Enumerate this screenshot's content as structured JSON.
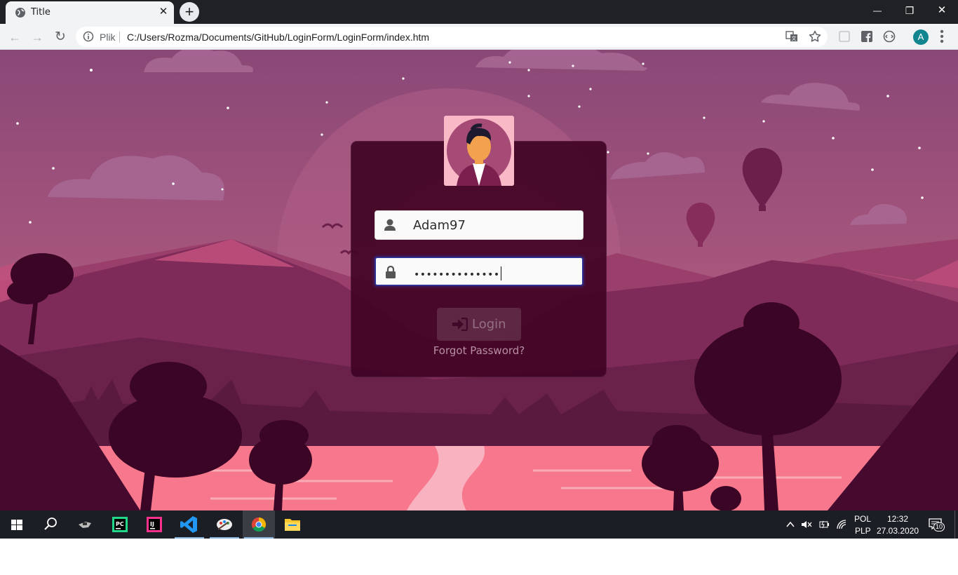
{
  "browser": {
    "tab_title": "Title",
    "tab_close": "✕",
    "new_tab": "+",
    "win_minimize": "—",
    "win_restore": "❐",
    "win_close": "✕",
    "back_icon": "←",
    "forward_icon": "→",
    "reload_icon": "↻",
    "url_scheme_label": "Plik",
    "url": "C:/Users/Rozma/Documents/GitHub/LoginForm/LoginForm/index.htm",
    "profile_initial": "A",
    "menu": "⋮"
  },
  "login": {
    "username_value": "Adam97",
    "password_value": "••••••••••••••",
    "login_label": "Login",
    "forgot_label": "Forgot Password?"
  },
  "taskbar": {
    "apps": [
      "start",
      "search",
      "explorer-tool",
      "pycharm",
      "intellij",
      "vscode",
      "paint",
      "chrome",
      "file-explorer"
    ],
    "lang_top": "POL",
    "lang_bottom": "PLP",
    "time": "12:32",
    "date": "27.03.2020",
    "notif_count": "10"
  },
  "colors": {
    "sky_top": "#8c4a78",
    "sky_bottom": "#c9647e",
    "card": "#400324",
    "lake": "#f7778d",
    "accent_focus": "#2e3192"
  }
}
